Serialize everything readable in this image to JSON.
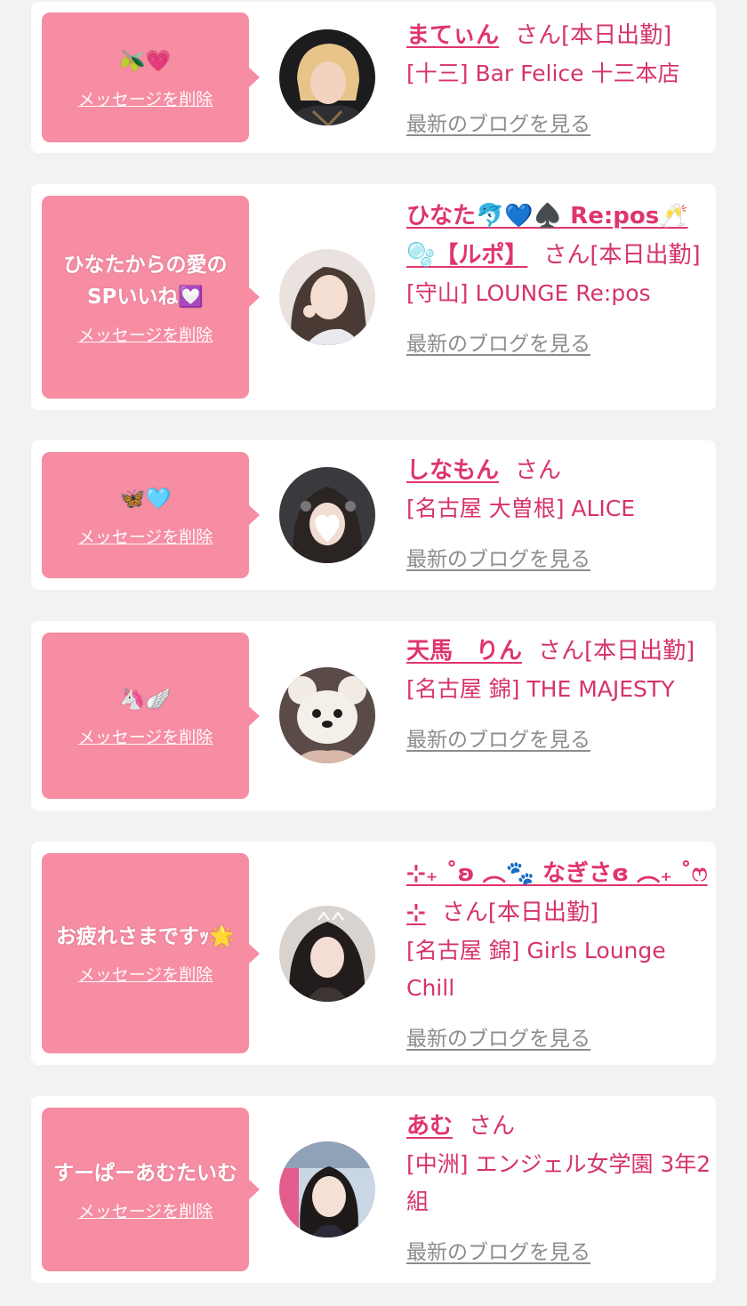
{
  "colors": {
    "page_bg": "#f2f2f2",
    "card_bg": "#ffffff",
    "bubble_bg": "#f68da3",
    "name": "#e0346d",
    "accent_text": "#d6336c",
    "blog_link": "#8c8c8c"
  },
  "delete_label": "メッセージを削除",
  "blog_label": "最新のブログを見る",
  "items": [
    {
      "message": "🫒💗",
      "name": "まてぃん",
      "suffix": "さん[本日出勤]",
      "location": "[十三] Bar Felice 十三本店",
      "avatar": "avatar-blonde-woman"
    },
    {
      "message": "ひなたからの愛のSPいいね💟",
      "name": "ひなた🐬💙♠️ Re:pos🥂🫧【ルポ】",
      "suffix": "さん[本日出勤]",
      "location": "[守山] LOUNGE Re:pos",
      "avatar": "avatar-long-hair-woman"
    },
    {
      "message": "🦋🩵",
      "name": "しなもん",
      "suffix": "さん",
      "location": "[名古屋 大曽根] ALICE",
      "avatar": "avatar-heart-face-woman"
    },
    {
      "message": "🦄🪽",
      "name": "天馬　りん",
      "suffix": "さん[本日出勤]",
      "location": "[名古屋 錦] THE MAJESTY",
      "avatar": "avatar-bear-mask"
    },
    {
      "message": "お疲れさまですｯ🌟",
      "name": "⊹₊ ˚ʚ ︵🐾 なぎさɞ ︵₊ ˚ෆ ⊹",
      "suffix": "さん[本日出勤]",
      "location": "[名古屋 錦] Girls Lounge Chill",
      "avatar": "avatar-dark-hair-woman"
    },
    {
      "message": "すーぱーあむたいむ",
      "name": "あむ",
      "suffix": "さん",
      "location": "[中洲] エンジェル女学園 3年2組",
      "avatar": "avatar-school-woman"
    }
  ]
}
